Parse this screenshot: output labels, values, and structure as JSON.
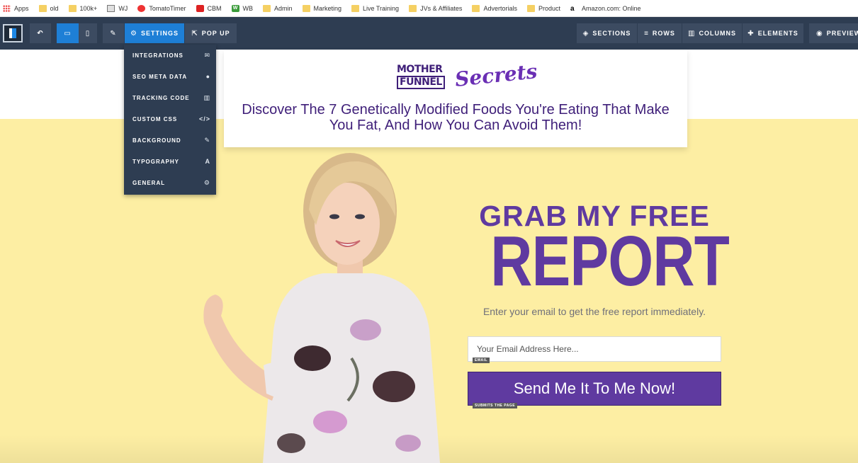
{
  "bookmarks": [
    {
      "label": "Apps",
      "icon": "apps-grid-icon"
    },
    {
      "label": "old",
      "icon": "folder-icon"
    },
    {
      "label": "100k+",
      "icon": "folder-icon"
    },
    {
      "label": "WJ",
      "icon": "site-icon"
    },
    {
      "label": "TomatoTimer",
      "icon": "tomato-icon"
    },
    {
      "label": "CBM",
      "icon": "cbm-icon"
    },
    {
      "label": "WB",
      "icon": "wb-icon"
    },
    {
      "label": "Admin",
      "icon": "folder-icon"
    },
    {
      "label": "Marketing",
      "icon": "folder-icon"
    },
    {
      "label": "Live Training",
      "icon": "folder-icon"
    },
    {
      "label": "JVs & Affiliates",
      "icon": "folder-icon"
    },
    {
      "label": "Advertorials",
      "icon": "folder-icon"
    },
    {
      "label": "Product",
      "icon": "folder-icon"
    },
    {
      "label": "Amazon.com: Online",
      "icon": "amazon-icon"
    }
  ],
  "toolbar": {
    "settings_label": "SETTINGS",
    "popup_label": "POP UP",
    "sections_label": "SECTIONS",
    "rows_label": "ROWS",
    "columns_label": "COLUMNS",
    "elements_label": "ELEMENTS",
    "preview_label": "PREVIEW"
  },
  "settings_menu": [
    {
      "label": "INTEGRATIONS",
      "icon": "envelope-icon",
      "glyph": "✉"
    },
    {
      "label": "SEO META DATA",
      "icon": "globe-icon",
      "glyph": "●"
    },
    {
      "label": "TRACKING CODE",
      "icon": "bar-chart-icon",
      "glyph": "▥"
    },
    {
      "label": "CUSTOM CSS",
      "icon": "code-icon",
      "glyph": "</>"
    },
    {
      "label": "BACKGROUND",
      "icon": "brush-icon",
      "glyph": "✎"
    },
    {
      "label": "TYPOGRAPHY",
      "icon": "font-icon",
      "glyph": "A"
    },
    {
      "label": "GENERAL",
      "icon": "gear-icon",
      "glyph": "⚙"
    }
  ],
  "page": {
    "brand_line1": "MOTHER",
    "brand_line2": "FUNNEL",
    "brand_script": "Secrets",
    "headline": "Discover The 7 Genetically Modified Foods You're Eating That Make You Fat, And How You Can Avoid Them!",
    "grab_text": "GRAB MY FREE",
    "report_text": "REPORT",
    "subtext": "Enter your email to get the free report immediately.",
    "email_placeholder": "Your Email Address Here...",
    "email_tag": "EMAIL",
    "cta_label": "Send Me It To Me Now!",
    "cta_tag": "SUBMITS THE PAGE"
  },
  "colors": {
    "toolbar_bg": "#2e3d52",
    "active_blue": "#1e7fd6",
    "brand_purple": "#5f3aa0",
    "page_yellow": "#fdeea3"
  }
}
